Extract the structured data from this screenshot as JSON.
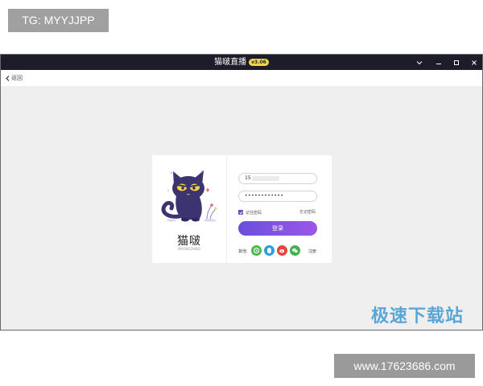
{
  "watermark_tag": "TG: MYYJJPP",
  "window": {
    "app_name": "猫啵直播",
    "version_badge": "v3.06",
    "back_label": "返回"
  },
  "login": {
    "brand_name": "猫啵",
    "brand_sub": "MAOBOZHIBO",
    "phone_value": "15",
    "password_value": "••••••••••••",
    "remember_label": "记住密码",
    "remember_checked": true,
    "forgot_label": "忘记密码",
    "login_button": "登录",
    "others_label": "其他:",
    "register_label": "注册",
    "social_icons": [
      "wechat-friends-icon",
      "qq-icon",
      "weibo-icon",
      "wechat-icon"
    ],
    "accent_color": "#6b48c8"
  },
  "site_watermark": "极速下载站",
  "url_tag": "www.17623686.com"
}
